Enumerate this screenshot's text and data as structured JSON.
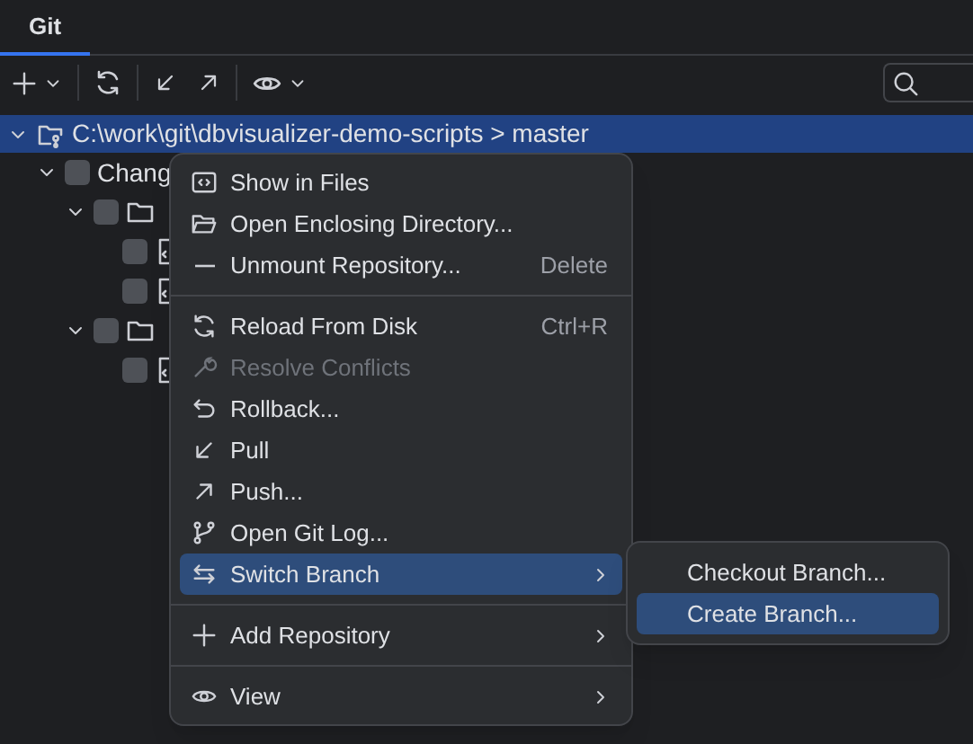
{
  "tabs": [
    {
      "label": "Git",
      "selected": true
    }
  ],
  "tree": {
    "label": "C:\\work\\git\\dbvisualizer-demo-scripts > master",
    "selected": true,
    "expanded": true,
    "children": [
      {
        "kind": "changelist",
        "label": "Chang",
        "expanded": true,
        "checked": false,
        "children": [
          {
            "kind": "folder",
            "expanded": true,
            "checked": false,
            "children": [
              {
                "kind": "file",
                "checked": false
              },
              {
                "kind": "file",
                "checked": false
              }
            ]
          },
          {
            "kind": "folder",
            "expanded": true,
            "checked": false,
            "children": [
              {
                "kind": "file",
                "checked": false
              }
            ]
          }
        ]
      }
    ]
  },
  "menu": [
    {
      "kind": "item",
      "label": "Show in Files",
      "selected": false,
      "disabled": false
    },
    {
      "kind": "item",
      "label": "Open Enclosing Directory...",
      "selected": false,
      "disabled": false
    },
    {
      "kind": "item",
      "label": "Unmount Repository...",
      "shortcut": "Delete",
      "selected": false,
      "disabled": false
    },
    {
      "kind": "separator"
    },
    {
      "kind": "item",
      "label": "Reload From Disk",
      "shortcut": "Ctrl+R",
      "selected": false,
      "disabled": false
    },
    {
      "kind": "item",
      "label": "Resolve Conflicts",
      "selected": false,
      "disabled": true
    },
    {
      "kind": "item",
      "label": "Rollback...",
      "selected": false,
      "disabled": false
    },
    {
      "kind": "item",
      "label": "Pull",
      "selected": false,
      "disabled": false
    },
    {
      "kind": "item",
      "label": "Push...",
      "selected": false,
      "disabled": false
    },
    {
      "kind": "item",
      "label": "Open Git Log...",
      "selected": false,
      "disabled": false
    },
    {
      "kind": "item",
      "label": "Switch Branch",
      "selected": true,
      "disabled": false,
      "submenu": true
    },
    {
      "kind": "separator"
    },
    {
      "kind": "item",
      "label": "Add Repository",
      "selected": false,
      "disabled": false,
      "submenu": true
    },
    {
      "kind": "separator"
    },
    {
      "kind": "item",
      "label": "View",
      "selected": false,
      "disabled": false,
      "submenu": true
    }
  ],
  "submenu": [
    {
      "label": "Checkout Branch...",
      "selected": false
    },
    {
      "label": "Create Branch...",
      "selected": true
    }
  ]
}
